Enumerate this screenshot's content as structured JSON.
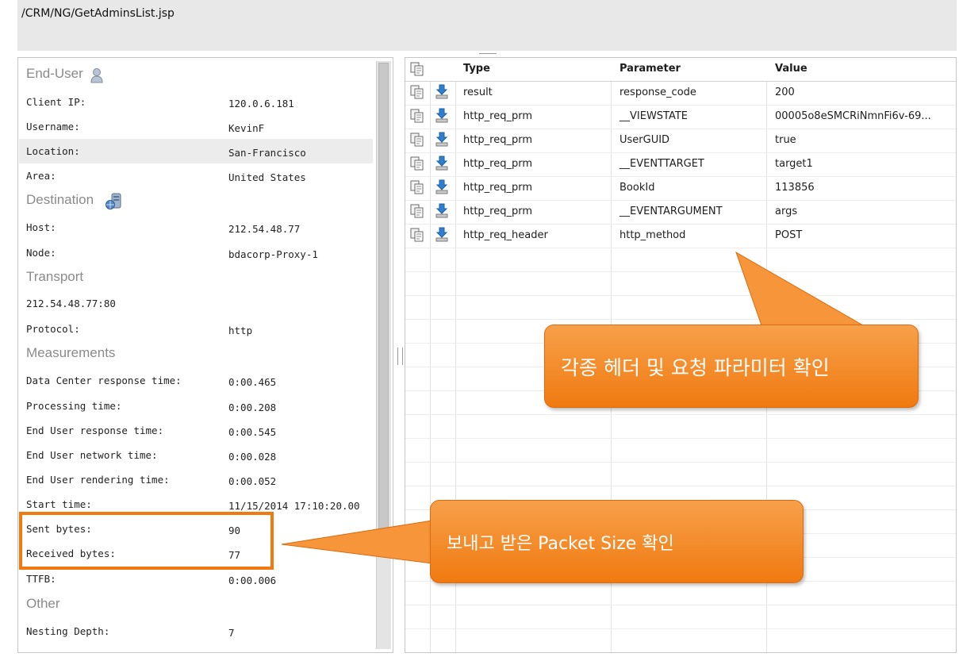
{
  "url_path": "/CRM/NG/GetAdminsList.jsp",
  "details": {
    "sections": {
      "end_user": "End-User",
      "destination": "Destination",
      "transport": "Transport",
      "measurements": "Measurements",
      "other": "Other"
    },
    "rows": [
      {
        "key": "Client IP:",
        "value": "120.0.6.181"
      },
      {
        "key": "Username:",
        "value": "KevinF"
      },
      {
        "key": "Location:",
        "value": "San-Francisco"
      },
      {
        "key": "Area:",
        "value": "United States"
      },
      {
        "key": "Host:",
        "value": "212.54.48.77"
      },
      {
        "key": "Node:",
        "value": "bdacorp-Proxy-1"
      },
      {
        "key": "212.54.48.77:80",
        "value": ""
      },
      {
        "key": "Protocol:",
        "value": "http"
      },
      {
        "key": "Data Center response time:",
        "value": "0:00.465"
      },
      {
        "key": "Processing time:",
        "value": "0:00.208"
      },
      {
        "key": "End User response time:",
        "value": "0:00.545"
      },
      {
        "key": "End User network time:",
        "value": "0:00.028"
      },
      {
        "key": "End User rendering time:",
        "value": "0:00.052"
      },
      {
        "key": "Start time:",
        "value": "11/15/2014 17:10:20.00"
      },
      {
        "key": "Sent bytes:",
        "value": "90"
      },
      {
        "key": "Received bytes:",
        "value": "77"
      },
      {
        "key": "TTFB:",
        "value": "0:00.006"
      },
      {
        "key": "Nesting Depth:",
        "value": "7"
      }
    ]
  },
  "grid": {
    "headers": {
      "type": "Type",
      "parameter": "Parameter",
      "value": "Value"
    },
    "rows": [
      {
        "type": "result",
        "parameter": "response_code",
        "value": "200"
      },
      {
        "type": "http_req_prm",
        "parameter": "__VIEWSTATE",
        "value": "00005o8eSMCRiNmnFi6v-69..."
      },
      {
        "type": "http_req_prm",
        "parameter": "UserGUID",
        "value": "true"
      },
      {
        "type": "http_req_prm",
        "parameter": "__EVENTTARGET",
        "value": "target1"
      },
      {
        "type": "http_req_prm",
        "parameter": "BookId",
        "value": "113856"
      },
      {
        "type": "http_req_prm",
        "parameter": "__EVENTARGUMENT",
        "value": "args"
      },
      {
        "type": "http_req_header",
        "parameter": "http_method",
        "value": "POST"
      }
    ]
  },
  "callouts": {
    "headers_params": "각종 헤더 및 요청 파라미터 확인",
    "packet_size": "보내고 받은 Packet Size 확인"
  },
  "colors": {
    "callout": "#f28a22",
    "highlight_box": "#f07a10"
  }
}
